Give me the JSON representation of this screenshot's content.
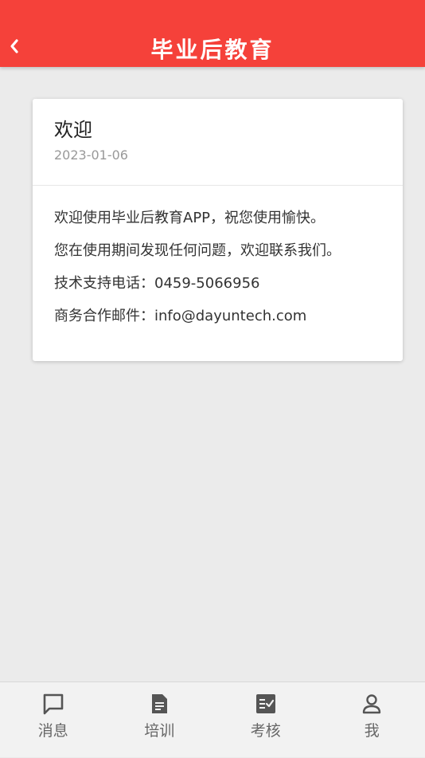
{
  "header": {
    "back_icon": "chevron-left-icon",
    "title": "毕业后教育"
  },
  "message": {
    "title": "欢迎",
    "date": "2023-01-06",
    "lines": [
      "欢迎使用毕业后教育APP，祝您使用愉快。",
      "您在使用期间发现任何问题，欢迎联系我们。",
      "技术支持电话：0459-5066956",
      "商务合作邮件：info@dayuntech.com"
    ]
  },
  "tabs": [
    {
      "label": "消息",
      "icon": "chat-bubble-icon"
    },
    {
      "label": "培训",
      "icon": "document-icon"
    },
    {
      "label": "考核",
      "icon": "checklist-icon"
    },
    {
      "label": "我",
      "icon": "person-icon"
    }
  ],
  "colors": {
    "header_bg": "#f5413a",
    "page_bg": "#ebebeb",
    "tab_icon": "#555555"
  }
}
